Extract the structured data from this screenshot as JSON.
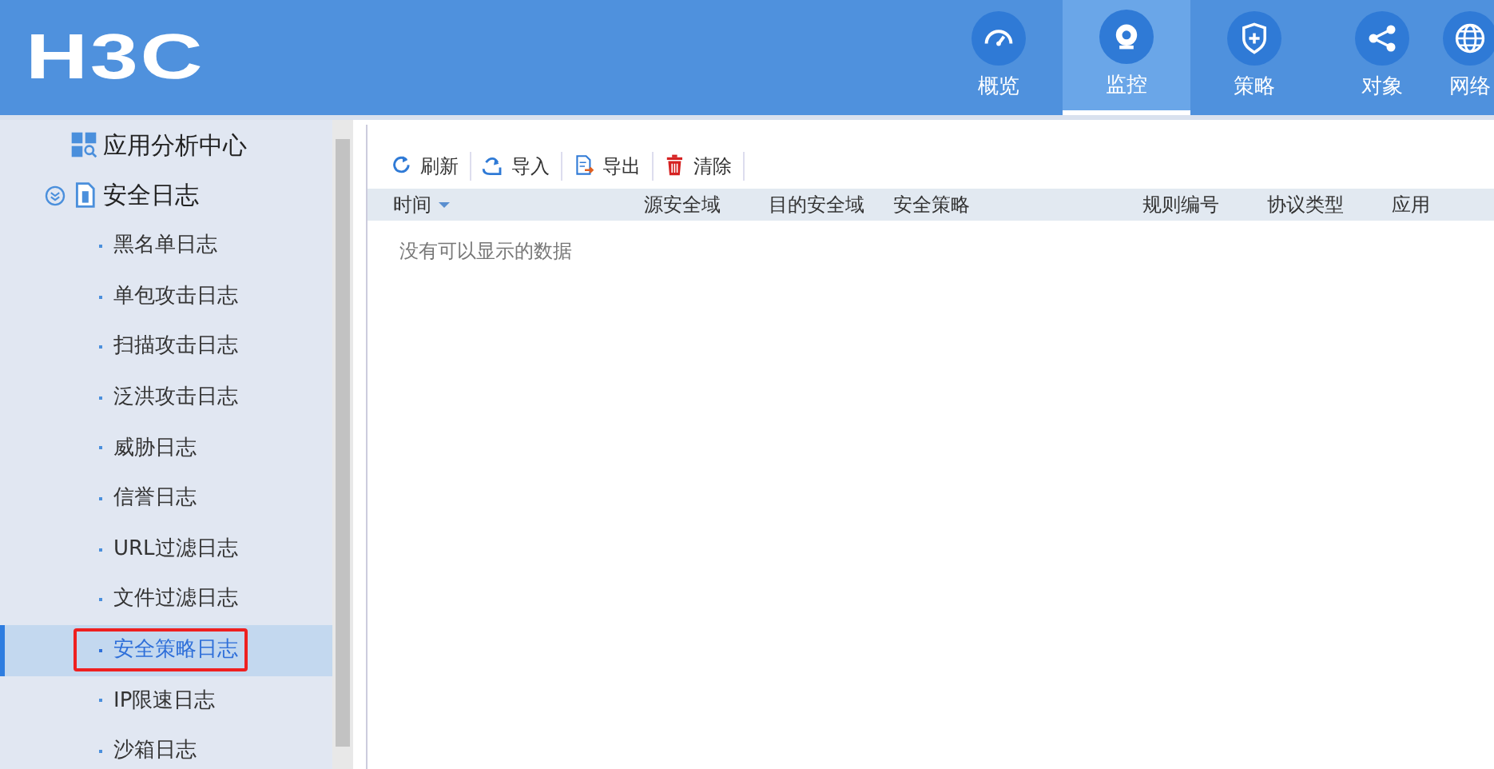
{
  "brand": {
    "logo": "H3C"
  },
  "nav": [
    {
      "label": "概览",
      "selected": false
    },
    {
      "label": "监控",
      "selected": true
    },
    {
      "label": "策略",
      "selected": false
    },
    {
      "label": "对象",
      "selected": false
    },
    {
      "label": "网络",
      "selected": false
    }
  ],
  "sidebar": {
    "items": [
      {
        "label": "应用分析中心",
        "kind": "group",
        "selected": false,
        "highlighted": false
      },
      {
        "label": "安全日志",
        "kind": "folder",
        "expanded": true,
        "selected": false,
        "highlighted": false,
        "children": [
          {
            "label": "黑名单日志",
            "selected": false,
            "highlighted": false
          },
          {
            "label": "单包攻击日志",
            "selected": false,
            "highlighted": false
          },
          {
            "label": "扫描攻击日志",
            "selected": false,
            "highlighted": false
          },
          {
            "label": "泛洪攻击日志",
            "selected": false,
            "highlighted": false
          },
          {
            "label": "威胁日志",
            "selected": false,
            "highlighted": false
          },
          {
            "label": "信誉日志",
            "selected": false,
            "highlighted": false
          },
          {
            "label": "URL过滤日志",
            "selected": false,
            "highlighted": false
          },
          {
            "label": "文件过滤日志",
            "selected": false,
            "highlighted": false
          },
          {
            "label": "安全策略日志",
            "selected": true,
            "highlighted": true
          },
          {
            "label": "IP限速日志",
            "selected": false,
            "highlighted": false
          },
          {
            "label": "沙箱日志",
            "selected": false,
            "highlighted": false
          }
        ]
      }
    ]
  },
  "toolbar": [
    {
      "label": "刷新"
    },
    {
      "label": "导入"
    },
    {
      "label": "导出"
    },
    {
      "label": "清除"
    }
  ],
  "table": {
    "columns": [
      {
        "label": "时间",
        "sorted": true
      },
      {
        "label": "源安全域",
        "sorted": false
      },
      {
        "label": "目的安全域",
        "sorted": false
      },
      {
        "label": "安全策略",
        "sorted": false
      },
      {
        "label": "规则编号",
        "sorted": false
      },
      {
        "label": "协议类型",
        "sorted": false
      },
      {
        "label": "应用",
        "sorted": false
      }
    ],
    "empty_text": "没有可以显示的数据"
  }
}
